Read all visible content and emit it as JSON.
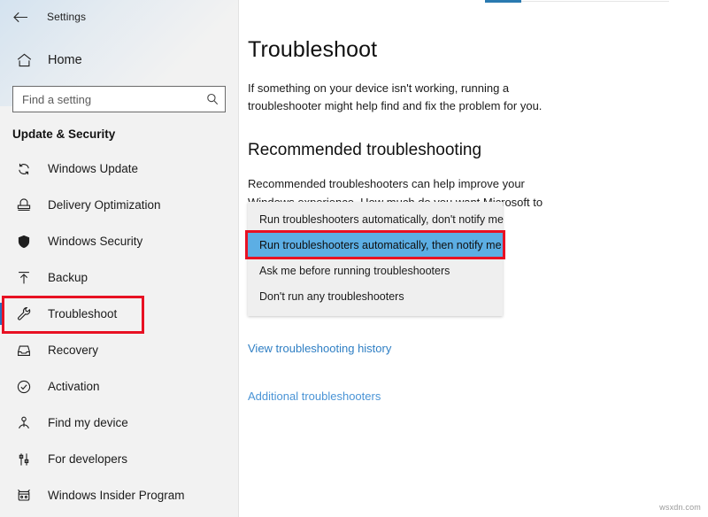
{
  "window": {
    "app_title": "Settings",
    "back_icon": "back-arrow-icon",
    "tab_indicator_color": "#2a7ab0"
  },
  "sidebar": {
    "home_label": "Home",
    "home_icon": "home-icon",
    "search": {
      "placeholder": "Find a setting",
      "value": "",
      "icon": "search-icon"
    },
    "section_title": "Update & Security",
    "items": [
      {
        "label": "Windows Update",
        "icon": "sync-icon",
        "selected": false,
        "annotated": false
      },
      {
        "label": "Delivery Optimization",
        "icon": "delivery-icon",
        "selected": false,
        "annotated": false
      },
      {
        "label": "Windows Security",
        "icon": "shield-icon",
        "selected": false,
        "annotated": false
      },
      {
        "label": "Backup",
        "icon": "backup-upload-icon",
        "selected": false,
        "annotated": false
      },
      {
        "label": "Troubleshoot",
        "icon": "wrench-icon",
        "selected": true,
        "annotated": true
      },
      {
        "label": "Recovery",
        "icon": "recovery-icon",
        "selected": false,
        "annotated": false
      },
      {
        "label": "Activation",
        "icon": "check-circle-icon",
        "selected": false,
        "annotated": false
      },
      {
        "label": "Find my device",
        "icon": "find-device-icon",
        "selected": false,
        "annotated": false
      },
      {
        "label": "For developers",
        "icon": "developers-icon",
        "selected": false,
        "annotated": false
      },
      {
        "label": "Windows Insider Program",
        "icon": "insider-icon",
        "selected": false,
        "annotated": false
      }
    ]
  },
  "main": {
    "page_title": "Troubleshoot",
    "page_subtitle": "If something on your device isn't working, running a troubleshooter might help find and fix the problem for you.",
    "section_heading": "Recommended troubleshooting",
    "section_body": "Recommended troubleshooters can help improve your Windows experience. How much do you want Microsoft to help when we find problems to fix?",
    "dropdown": {
      "options": [
        {
          "label": "Run troubleshooters automatically, don't notify me",
          "highlighted": false,
          "annotated": false
        },
        {
          "label": "Run troubleshooters automatically, then notify me",
          "highlighted": true,
          "annotated": true
        },
        {
          "label": "Ask me before running troubleshooters",
          "highlighted": false,
          "annotated": false
        },
        {
          "label": "Don't run any troubleshooters",
          "highlighted": false,
          "annotated": false
        }
      ],
      "highlight_color": "#5caee4",
      "annotation_color": "#e81123"
    },
    "links": [
      {
        "label": "View troubleshooting history"
      },
      {
        "label": "Additional troubleshooters"
      }
    ]
  },
  "watermark": "wsxdn.com"
}
